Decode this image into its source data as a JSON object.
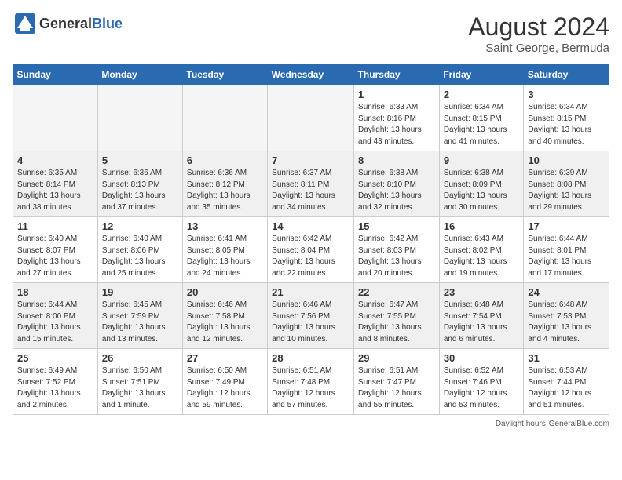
{
  "header": {
    "logo_general": "General",
    "logo_blue": "Blue",
    "month_year": "August 2024",
    "location": "Saint George, Bermuda"
  },
  "days_of_week": [
    "Sunday",
    "Monday",
    "Tuesday",
    "Wednesday",
    "Thursday",
    "Friday",
    "Saturday"
  ],
  "weeks": [
    [
      {
        "day": "",
        "info": ""
      },
      {
        "day": "",
        "info": ""
      },
      {
        "day": "",
        "info": ""
      },
      {
        "day": "",
        "info": ""
      },
      {
        "day": "1",
        "info": "Sunrise: 6:33 AM\nSunset: 8:16 PM\nDaylight: 13 hours\nand 43 minutes."
      },
      {
        "day": "2",
        "info": "Sunrise: 6:34 AM\nSunset: 8:15 PM\nDaylight: 13 hours\nand 41 minutes."
      },
      {
        "day": "3",
        "info": "Sunrise: 6:34 AM\nSunset: 8:15 PM\nDaylight: 13 hours\nand 40 minutes."
      }
    ],
    [
      {
        "day": "4",
        "info": "Sunrise: 6:35 AM\nSunset: 8:14 PM\nDaylight: 13 hours\nand 38 minutes."
      },
      {
        "day": "5",
        "info": "Sunrise: 6:36 AM\nSunset: 8:13 PM\nDaylight: 13 hours\nand 37 minutes."
      },
      {
        "day": "6",
        "info": "Sunrise: 6:36 AM\nSunset: 8:12 PM\nDaylight: 13 hours\nand 35 minutes."
      },
      {
        "day": "7",
        "info": "Sunrise: 6:37 AM\nSunset: 8:11 PM\nDaylight: 13 hours\nand 34 minutes."
      },
      {
        "day": "8",
        "info": "Sunrise: 6:38 AM\nSunset: 8:10 PM\nDaylight: 13 hours\nand 32 minutes."
      },
      {
        "day": "9",
        "info": "Sunrise: 6:38 AM\nSunset: 8:09 PM\nDaylight: 13 hours\nand 30 minutes."
      },
      {
        "day": "10",
        "info": "Sunrise: 6:39 AM\nSunset: 8:08 PM\nDaylight: 13 hours\nand 29 minutes."
      }
    ],
    [
      {
        "day": "11",
        "info": "Sunrise: 6:40 AM\nSunset: 8:07 PM\nDaylight: 13 hours\nand 27 minutes."
      },
      {
        "day": "12",
        "info": "Sunrise: 6:40 AM\nSunset: 8:06 PM\nDaylight: 13 hours\nand 25 minutes."
      },
      {
        "day": "13",
        "info": "Sunrise: 6:41 AM\nSunset: 8:05 PM\nDaylight: 13 hours\nand 24 minutes."
      },
      {
        "day": "14",
        "info": "Sunrise: 6:42 AM\nSunset: 8:04 PM\nDaylight: 13 hours\nand 22 minutes."
      },
      {
        "day": "15",
        "info": "Sunrise: 6:42 AM\nSunset: 8:03 PM\nDaylight: 13 hours\nand 20 minutes."
      },
      {
        "day": "16",
        "info": "Sunrise: 6:43 AM\nSunset: 8:02 PM\nDaylight: 13 hours\nand 19 minutes."
      },
      {
        "day": "17",
        "info": "Sunrise: 6:44 AM\nSunset: 8:01 PM\nDaylight: 13 hours\nand 17 minutes."
      }
    ],
    [
      {
        "day": "18",
        "info": "Sunrise: 6:44 AM\nSunset: 8:00 PM\nDaylight: 13 hours\nand 15 minutes."
      },
      {
        "day": "19",
        "info": "Sunrise: 6:45 AM\nSunset: 7:59 PM\nDaylight: 13 hours\nand 13 minutes."
      },
      {
        "day": "20",
        "info": "Sunrise: 6:46 AM\nSunset: 7:58 PM\nDaylight: 13 hours\nand 12 minutes."
      },
      {
        "day": "21",
        "info": "Sunrise: 6:46 AM\nSunset: 7:56 PM\nDaylight: 13 hours\nand 10 minutes."
      },
      {
        "day": "22",
        "info": "Sunrise: 6:47 AM\nSunset: 7:55 PM\nDaylight: 13 hours\nand 8 minutes."
      },
      {
        "day": "23",
        "info": "Sunrise: 6:48 AM\nSunset: 7:54 PM\nDaylight: 13 hours\nand 6 minutes."
      },
      {
        "day": "24",
        "info": "Sunrise: 6:48 AM\nSunset: 7:53 PM\nDaylight: 13 hours\nand 4 minutes."
      }
    ],
    [
      {
        "day": "25",
        "info": "Sunrise: 6:49 AM\nSunset: 7:52 PM\nDaylight: 13 hours\nand 2 minutes."
      },
      {
        "day": "26",
        "info": "Sunrise: 6:50 AM\nSunset: 7:51 PM\nDaylight: 13 hours\nand 1 minute."
      },
      {
        "day": "27",
        "info": "Sunrise: 6:50 AM\nSunset: 7:49 PM\nDaylight: 12 hours\nand 59 minutes."
      },
      {
        "day": "28",
        "info": "Sunrise: 6:51 AM\nSunset: 7:48 PM\nDaylight: 12 hours\nand 57 minutes."
      },
      {
        "day": "29",
        "info": "Sunrise: 6:51 AM\nSunset: 7:47 PM\nDaylight: 12 hours\nand 55 minutes."
      },
      {
        "day": "30",
        "info": "Sunrise: 6:52 AM\nSunset: 7:46 PM\nDaylight: 12 hours\nand 53 minutes."
      },
      {
        "day": "31",
        "info": "Sunrise: 6:53 AM\nSunset: 7:44 PM\nDaylight: 12 hours\nand 51 minutes."
      }
    ]
  ],
  "footer": {
    "label": "Daylight hours",
    "source": "GeneralBlue.com"
  }
}
